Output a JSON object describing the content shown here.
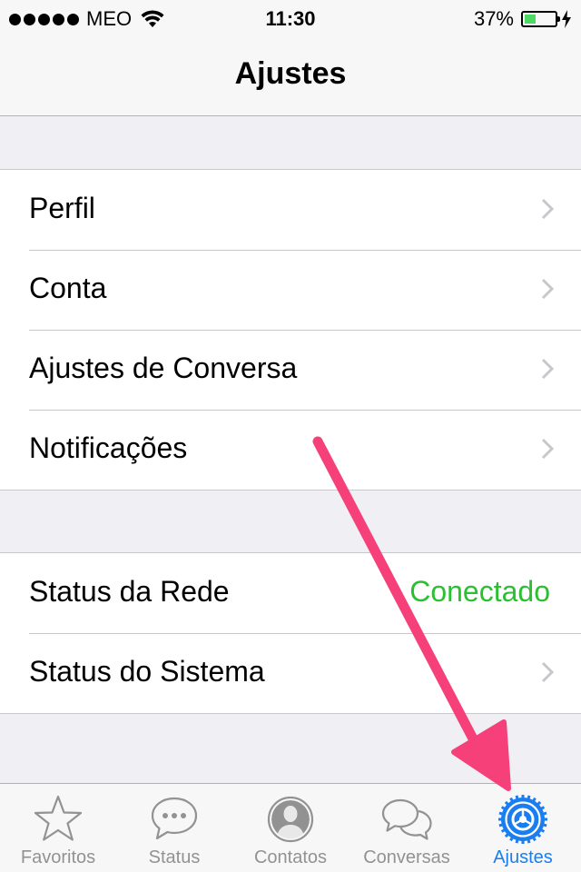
{
  "status_bar": {
    "carrier": "MEO",
    "time": "11:30",
    "battery_percent": "37%",
    "battery_level": 0.37,
    "battery_color": "#4cd964"
  },
  "nav": {
    "title": "Ajustes"
  },
  "sections": [
    {
      "rows": [
        {
          "label": "Perfil",
          "accessory": "chevron"
        },
        {
          "label": "Conta",
          "accessory": "chevron"
        },
        {
          "label": "Ajustes de Conversa",
          "accessory": "chevron"
        },
        {
          "label": "Notificações",
          "accessory": "chevron"
        }
      ]
    },
    {
      "rows": [
        {
          "label": "Status da Rede",
          "value": "Conectado",
          "value_color": "#2ac032"
        },
        {
          "label": "Status do Sistema",
          "accessory": "chevron"
        }
      ]
    }
  ],
  "tab_bar": {
    "tabs": [
      {
        "label": "Favoritos",
        "icon": "star-icon",
        "active": false
      },
      {
        "label": "Status",
        "icon": "speech-bubble-dots-icon",
        "active": false
      },
      {
        "label": "Contatos",
        "icon": "person-silhouette-icon",
        "active": false
      },
      {
        "label": "Conversas",
        "icon": "two-speech-bubbles-icon",
        "active": false
      },
      {
        "label": "Ajustes",
        "icon": "gear-icon",
        "active": true
      }
    ],
    "active_color": "#1a7ef0",
    "inactive_color": "#929292"
  },
  "annotation": {
    "arrow_color": "#f5407a"
  }
}
